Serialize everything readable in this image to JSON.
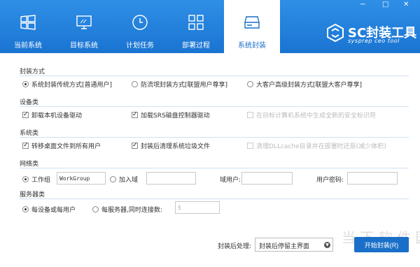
{
  "window": {
    "min": "−",
    "restore": "□",
    "close": "✕"
  },
  "nav": [
    {
      "label": "当前系统"
    },
    {
      "label": "目标系统"
    },
    {
      "label": "计划任务"
    },
    {
      "label": "部署过程"
    },
    {
      "label": "系统封装"
    }
  ],
  "brand": {
    "title": "SC封装工具",
    "subtitle": "sysprep ceo tool"
  },
  "sections": {
    "mode": {
      "title": "封装方式",
      "options": [
        "系统封装传统方式[普通用户]",
        "防流氓封装方式[联盟用户尊享]",
        "大客户高级封装方式[联盟大客户尊享]"
      ]
    },
    "device": {
      "title": "设备类",
      "options": [
        "卸载本机设备驱动",
        "加载SRS磁盘控制器驱动",
        "在目标计算机系统中生成全新的安全标识符"
      ]
    },
    "system": {
      "title": "系统类",
      "options": [
        "转移桌面文件到所有用户",
        "封装后清理系统垃圾文件",
        "清理DLLcache目录并在部署时还原(减少体积)"
      ]
    },
    "network": {
      "title": "网络类",
      "workgroup_label": "工作组",
      "workgroup_value": "WorkGroup",
      "domain_label": "加入域",
      "domain_user_label": "域用户:",
      "domain_pwd_label": "用户密码:"
    },
    "server": {
      "title": "服务器类",
      "per_device_label": "每设备或每用户",
      "per_server_label": "每服务器,同时连接数:",
      "connections": "5"
    }
  },
  "footer": {
    "post_label": "封装后处理:",
    "post_value": "封装后停留主界面",
    "arrow": "▼",
    "start_label": "开始封装(R)"
  },
  "watermark": "当 下 软 件 园"
}
